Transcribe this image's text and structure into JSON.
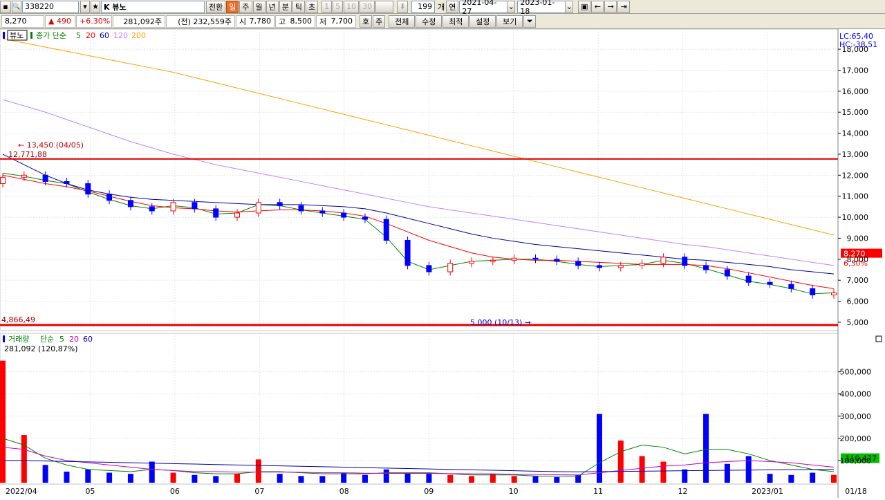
{
  "toolbar": {
    "code": "338220",
    "name": "K 뷰노",
    "btn_view": "전환",
    "periods": [
      "일",
      "주",
      "월",
      "년",
      "분",
      "틱",
      "초"
    ],
    "minutes": [
      "1",
      "5",
      "10",
      "30"
    ],
    "count": "199",
    "count_unit": "개",
    "date_label": "연",
    "date_from": "2021-04-27",
    "date_to": "2023-01-18"
  },
  "quote": {
    "price": "8,270",
    "change": "▲ 490",
    "change_pct": "+6.30%",
    "volume": "281,092주",
    "prev_volume": "(전) 232,559주",
    "open_label": "시",
    "open": "7,780",
    "high_label": "고",
    "high": "8,500",
    "low_label": "저",
    "low": "7,700",
    "tabs": [
      "호",
      "주"
    ],
    "menus": [
      "전체",
      "수정",
      "최적",
      "설정",
      "보기"
    ]
  },
  "colors": {
    "up": "#ff0000",
    "down": "#0000ff",
    "ma5": "#008000",
    "ma20": "#ff0000",
    "ma60": "#0000a0",
    "ma120": "#c080ff",
    "ma200": "#ffa000"
  },
  "chart_data": [
    {
      "type": "line",
      "title": "",
      "legend": {
        "stock": "뷰노",
        "ma_title": "종가 단순",
        "periods": [
          "5",
          "20",
          "60",
          "120",
          "200"
        ]
      },
      "x_ticks": [
        "2022/04",
        "05",
        "06",
        "07",
        "08",
        "09",
        "10",
        "11",
        "12",
        "2023/01"
      ],
      "x_end_label": "01/18",
      "y_ticks": [
        "18,000",
        "17,000",
        "16,000",
        "15,000",
        "14,000",
        "13,000",
        "12,000",
        "11,000",
        "10,000",
        "9,000",
        "8,000",
        "7,000",
        "6,000",
        "5,000"
      ],
      "ylim": [
        4800,
        18300
      ],
      "corner_labels": {
        "lc": "LC:65,40",
        "hc": "HC:-38,51"
      },
      "last_price": {
        "value": "8,270",
        "pct": "6,30%",
        "y": 8270
      },
      "annotations": {
        "high": {
          "text": "13,450 (04/05)",
          "y": 13450
        },
        "low": {
          "text": "5,000 (10/13)",
          "y": 5000
        },
        "level_line": {
          "text": "12,771,88",
          "y": 12771
        },
        "low_line": {
          "text": "4,866,49",
          "y": 4866
        }
      },
      "x": [
        0,
        5,
        10,
        15,
        20,
        25,
        30,
        35,
        40,
        45,
        50,
        55,
        60,
        65,
        70,
        75,
        80,
        85,
        90,
        95,
        100,
        105,
        110,
        115,
        120,
        125,
        130,
        135,
        140,
        145,
        150,
        155,
        160,
        165,
        170,
        175,
        180,
        185,
        190,
        195
      ],
      "close": [
        11900,
        12000,
        11700,
        11600,
        11100,
        10800,
        10500,
        10300,
        10700,
        10400,
        10000,
        10200,
        10700,
        10550,
        10300,
        10200,
        10000,
        9900,
        8900,
        7700,
        7400,
        7800,
        7900,
        7950,
        8050,
        8000,
        7900,
        7700,
        7600,
        7700,
        7800,
        8100,
        7700,
        7500,
        7200,
        6900,
        6800,
        6600,
        6300,
        6400
      ],
      "series": [
        {
          "name": "5",
          "values": [
            12100,
            11950,
            11750,
            11600,
            11200,
            10850,
            10550,
            10400,
            10550,
            10450,
            10150,
            10200,
            10600,
            10550,
            10350,
            10200,
            10050,
            9900,
            9050,
            7900,
            7500,
            7700,
            7900,
            7950,
            8000,
            8000,
            7900,
            7750,
            7650,
            7700,
            7750,
            7950,
            7800,
            7550,
            7250,
            6950,
            6800,
            6600,
            6350,
            6400
          ]
        },
        {
          "name": "20",
          "values": [
            12000,
            11800,
            11600,
            11450,
            11250,
            11000,
            10750,
            10550,
            10450,
            10400,
            10300,
            10250,
            10300,
            10350,
            10350,
            10300,
            10200,
            10050,
            9700,
            9300,
            8900,
            8600,
            8300,
            8100,
            8000,
            7950,
            7950,
            7900,
            7850,
            7800,
            7750,
            7750,
            7750,
            7700,
            7550,
            7350,
            7150,
            6950,
            6750,
            6600
          ]
        },
        {
          "name": "60",
          "values": [
            13000,
            12500,
            12000,
            11600,
            11300,
            11100,
            10950,
            10850,
            10800,
            10750,
            10700,
            10650,
            10600,
            10600,
            10600,
            10550,
            10500,
            10400,
            10200,
            9950,
            9700,
            9450,
            9200,
            9000,
            8850,
            8700,
            8600,
            8500,
            8400,
            8300,
            8200,
            8100,
            8000,
            7950,
            7850,
            7750,
            7650,
            7500,
            7400,
            7300
          ]
        },
        {
          "name": "120",
          "values": [
            15600,
            15300,
            15000,
            14650,
            14300,
            13950,
            13600,
            13300,
            13000,
            12750,
            12500,
            12300,
            12100,
            11900,
            11700,
            11500,
            11300,
            11100,
            10900,
            10700,
            10500,
            10350,
            10200,
            10050,
            9900,
            9750,
            9600,
            9450,
            9300,
            9150,
            9000,
            8850,
            8700,
            8600,
            8450,
            8300,
            8150,
            8000,
            7850,
            7700
          ]
        },
        {
          "name": "200",
          "values": [
            18500,
            18300,
            18100,
            17900,
            17700,
            17500,
            17300,
            17100,
            16900,
            16650,
            16400,
            16150,
            15900,
            15650,
            15400,
            15150,
            14900,
            14650,
            14400,
            14150,
            13900,
            13650,
            13400,
            13150,
            12900,
            12650,
            12400,
            12150,
            11900,
            11650,
            11400,
            11150,
            10900,
            10650,
            10400,
            10150,
            9900,
            9650,
            9400,
            9150
          ]
        }
      ]
    },
    {
      "type": "bar",
      "title": "",
      "legend": {
        "name": "거래량",
        "ma_title": "단순",
        "periods": [
          "5",
          "20",
          "60"
        ]
      },
      "top_label": "281,092 (120,87%)",
      "y_ticks": [
        "500,000",
        "400,000",
        "300,000",
        "200,000",
        "100,000"
      ],
      "ylim": [
        0,
        580000
      ],
      "last_value": {
        "text": "110,477",
        "y": 110477
      },
      "x": [
        0,
        5,
        10,
        15,
        20,
        25,
        30,
        35,
        40,
        45,
        50,
        55,
        60,
        65,
        70,
        75,
        80,
        85,
        90,
        95,
        100,
        105,
        110,
        115,
        120,
        125,
        130,
        135,
        140,
        145,
        150,
        155,
        160,
        165,
        170,
        175,
        180,
        185,
        190,
        195
      ],
      "values": [
        550000,
        215000,
        80000,
        50000,
        60000,
        45000,
        40000,
        95000,
        45000,
        35000,
        30000,
        40000,
        105000,
        40000,
        30000,
        30000,
        45000,
        35000,
        60000,
        45000,
        40000,
        35000,
        30000,
        40000,
        30000,
        30000,
        25000,
        35000,
        310000,
        190000,
        120000,
        95000,
        60000,
        310000,
        85000,
        120000,
        40000,
        35000,
        45000,
        35000
      ],
      "series": [
        {
          "name": "5",
          "values": [
            200000,
            170000,
            110000,
            80000,
            60000,
            55000,
            50000,
            60000,
            55000,
            45000,
            40000,
            40000,
            50000,
            50000,
            45000,
            40000,
            40000,
            40000,
            45000,
            45000,
            45000,
            40000,
            35000,
            35000,
            35000,
            30000,
            30000,
            30000,
            90000,
            140000,
            170000,
            160000,
            130000,
            150000,
            150000,
            130000,
            100000,
            80000,
            60000,
            50000
          ]
        },
        {
          "name": "20",
          "values": [
            160000,
            150000,
            120000,
            100000,
            90000,
            80000,
            70000,
            60000,
            55000,
            50000,
            50000,
            48000,
            48000,
            48000,
            47000,
            45000,
            45000,
            43000,
            42000,
            42000,
            42000,
            41000,
            40000,
            40000,
            38000,
            37000,
            36000,
            35000,
            45000,
            55000,
            65000,
            75000,
            80000,
            90000,
            95000,
            100000,
            95000,
            90000,
            80000,
            70000
          ]
        },
        {
          "name": "60",
          "values": [
            100000,
            100000,
            98000,
            96000,
            94000,
            92000,
            90000,
            88000,
            86000,
            84000,
            82000,
            80000,
            78000,
            76000,
            74000,
            72000,
            70000,
            68000,
            66000,
            64000,
            62000,
            60000,
            58000,
            56000,
            54000,
            52000,
            50000,
            49000,
            50000,
            51000,
            52000,
            53000,
            54000,
            55000,
            56000,
            57000,
            58000,
            59000,
            59000,
            60000
          ]
        }
      ]
    }
  ]
}
